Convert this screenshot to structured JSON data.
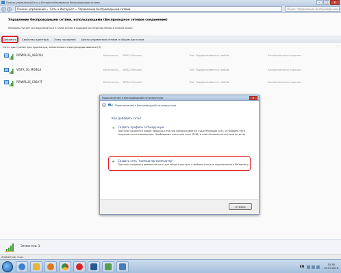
{
  "window": {
    "title": "Панель управления\\Сеть и Интернет\\Управление беспроводными сетями"
  },
  "address": {
    "crumbs": [
      "Панель управления",
      "Сеть и Интернет",
      "Управление беспроводными сетями"
    ],
    "separator": "▸",
    "search_placeholder": "Поиск: Управление беспроводными..."
  },
  "header": {
    "title": "Управление беспроводными сетями, использующими (Беспроводное сетевое соединение)",
    "subtitle": "Windows пытается подключаться к этим сетям в порядке их перечисления в списке ниже."
  },
  "toolbar": {
    "items": [
      "Добавить",
      "Свойства адаптера",
      "Типы профилей",
      "Центр управления сетями и общим доступом"
    ]
  },
  "list": {
    "section_label": "Сети, доступные для просмотра, изменения и переупорядочивания (3)",
    "networks": [
      {
        "name": "RPIWRLUS_AE6CDA",
        "security": "Безопасно...",
        "auth": "WPA2-Personal",
        "type": "Тип: Поддерживается любой",
        "connect": "Автоматически подключ"
      },
      {
        "name": "VISTA_3G_MOBILE",
        "security": "Безопасно...",
        "auth": "WPA2-Personal",
        "type": "Тип: Поддерживается любой",
        "connect": "Автоматически подключ"
      },
      {
        "name": "RPIWRLUS_C86A7F",
        "security": "Безопасно...",
        "auth": "WPA2-Personal",
        "type": "Тип: Поддерживается любой",
        "connect": "Автоматически подключ"
      }
    ]
  },
  "status": {
    "items_label": "Элементов: 3",
    "statusbar_text": "Элементов: 3 шт."
  },
  "taskbar": {
    "lang": "EN",
    "time": "15:38",
    "date": "05.09.2018"
  },
  "dialog": {
    "title": "Подключение к беспроводной сети вручную",
    "header": "Подключение к беспроводной сети вручную",
    "question": "Как добавить сеть?",
    "option1_title": "Создать профиль сети вручную",
    "option1_desc": "При этом создается новый профиль сети или обнаруживается существующая сеть, и профиль сети сохраняется на компьютере. Необходимо знать имя сети (SSID) и ключ безопасности (если он есть).",
    "option2_title": "Создать сеть \"компьютер-компьютер\"",
    "option2_desc": "При этом создается временная сеть для общего доступа к файлам или для подключения к Интернету",
    "cancel": "Отмена"
  },
  "colors": {
    "highlight": "#e0232b",
    "accent": "#1f3d6c"
  }
}
